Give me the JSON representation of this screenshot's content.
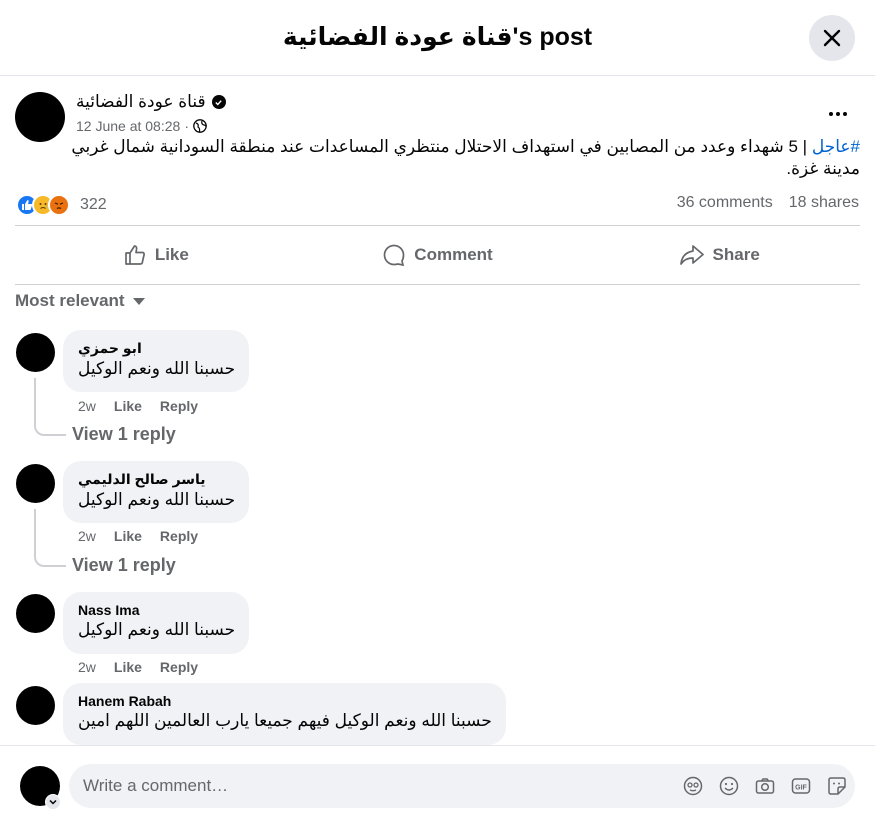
{
  "header": {
    "title": "قناة عودة الفضائية's post"
  },
  "post": {
    "author": "قناة عودة الفضائية",
    "timestamp": "12 June at 08:28",
    "hashtag": "#عاجل",
    "text": " | 5 شهداء وعدد من المصابين في استهداف الاحتلال منتظري المساعدات عند منطقة السودانية شمال غربي مدينة غزة.",
    "reaction_count": "322",
    "comments_count": "36 comments",
    "shares_count": "18 shares"
  },
  "actions": {
    "like": "Like",
    "comment": "Comment",
    "share": "Share"
  },
  "sort": {
    "label": "Most relevant"
  },
  "comments": [
    {
      "author": "ابو حمزي",
      "text": "حسبنا الله ونعم الوكيل",
      "time": "2w",
      "like": "Like",
      "reply": "Reply",
      "view_replies": "View 1 reply"
    },
    {
      "author": "ياسر صالح الدليمي",
      "text": "حسبنا الله ونعم الوكيل",
      "time": "2w",
      "like": "Like",
      "reply": "Reply",
      "view_replies": "View 1 reply"
    },
    {
      "author": "Nass Ima",
      "text": "حسبنا الله ونعم الوكيل",
      "time": "2w",
      "like": "Like",
      "reply": "Reply"
    },
    {
      "author": "Hanem Rabah",
      "text": "حسبنا الله ونعم الوكيل فيهم جميعا يارب العالمين اللهم امين"
    }
  ],
  "composer": {
    "placeholder": "Write a comment…"
  },
  "colors": {
    "like_blue": "#1877f2",
    "hashtag_blue": "#0064d1",
    "muted_text": "#65676b",
    "bubble_bg": "#f0f2f5"
  }
}
